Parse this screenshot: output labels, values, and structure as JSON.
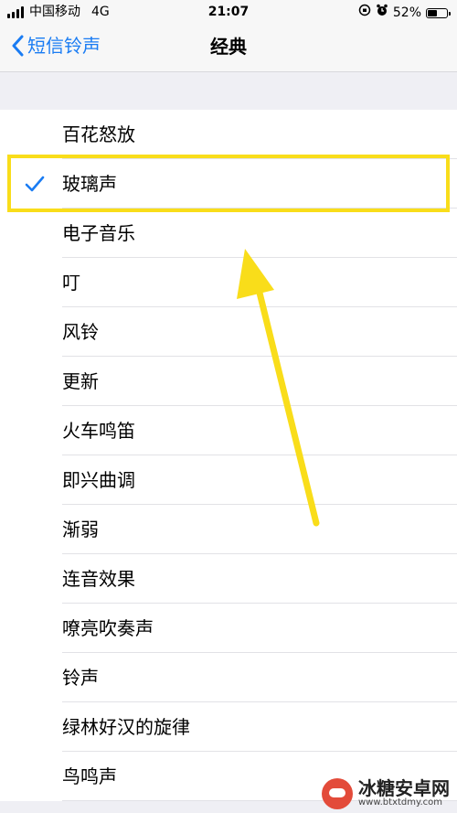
{
  "status_bar": {
    "carrier": "中国移动",
    "network": "4G",
    "time": "21:07",
    "battery_percent": "52%",
    "battery_level": 0.52
  },
  "nav": {
    "back_label": "短信铃声",
    "title": "经典"
  },
  "ringtones": [
    {
      "label": "百花怒放",
      "selected": false
    },
    {
      "label": "玻璃声",
      "selected": true
    },
    {
      "label": "电子音乐",
      "selected": false
    },
    {
      "label": "叮",
      "selected": false
    },
    {
      "label": "风铃",
      "selected": false
    },
    {
      "label": "更新",
      "selected": false
    },
    {
      "label": "火车鸣笛",
      "selected": false
    },
    {
      "label": "即兴曲调",
      "selected": false
    },
    {
      "label": "渐弱",
      "selected": false
    },
    {
      "label": "连音效果",
      "selected": false
    },
    {
      "label": "嘹亮吹奏声",
      "selected": false
    },
    {
      "label": "铃声",
      "selected": false
    },
    {
      "label": "绿林好汉的旋律",
      "selected": false
    },
    {
      "label": "鸟鸣声",
      "selected": false
    }
  ],
  "watermark": {
    "name": "冰糖安卓网",
    "url": "www.btxtdmy.com"
  },
  "colors": {
    "accent": "#1a7cf3",
    "annotation": "#f9dd1a"
  }
}
